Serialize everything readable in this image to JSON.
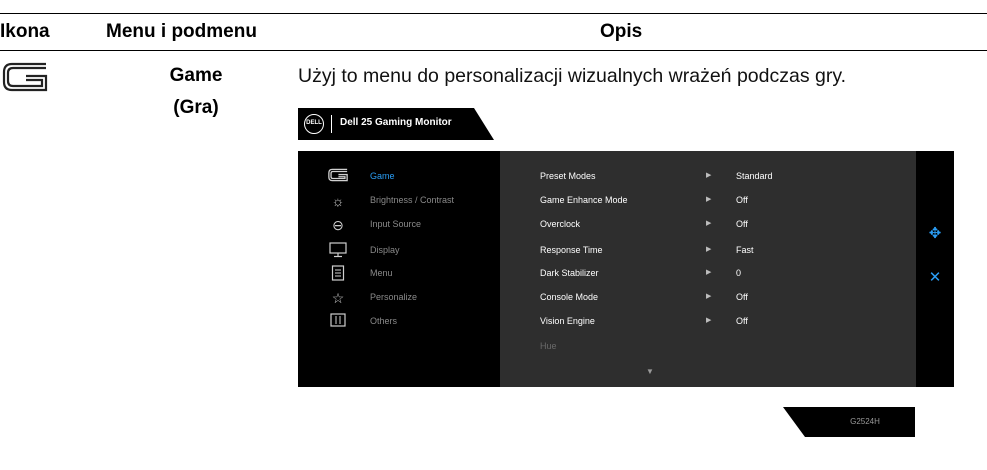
{
  "table": {
    "headers": {
      "icon": "Ikona",
      "menu": "Menu i podmenu",
      "description": "Opis"
    },
    "row": {
      "icon": "game-icon",
      "menu_line1": "Game",
      "menu_line2": "(Gra)",
      "description": "Użyj to menu do personalizacji wizualnych wrażeń podczas gry."
    }
  },
  "osd": {
    "logo_text": "DELL",
    "title": "Dell 25 Gaming Monitor",
    "nav": [
      {
        "label": "Game",
        "icon": "game-icon",
        "active": true
      },
      {
        "label": "Brightness / Contrast",
        "icon": "brightness-icon",
        "active": false
      },
      {
        "label": "Input Source",
        "icon": "input-source-icon",
        "active": false
      },
      {
        "label": "Display",
        "icon": "display-icon",
        "active": false
      },
      {
        "label": "Menu",
        "icon": "menu-icon",
        "active": false
      },
      {
        "label": "Personalize",
        "icon": "star-icon",
        "active": false
      },
      {
        "label": "Others",
        "icon": "others-icon",
        "active": false
      }
    ],
    "settings": [
      {
        "label": "Preset Modes",
        "value": "Standard"
      },
      {
        "label": "Game Enhance Mode",
        "value": "Off"
      },
      {
        "label": "Overclock",
        "value": "Off"
      },
      {
        "label": "Response Time",
        "value": "Fast"
      },
      {
        "label": "Dark Stabilizer",
        "value": "0"
      },
      {
        "label": "Console Mode",
        "value": "Off"
      },
      {
        "label": "Vision Engine",
        "value": "Off"
      },
      {
        "label": "Hue",
        "value": ""
      }
    ],
    "side_icons": [
      "move-icon",
      "close-icon"
    ],
    "model": "G2524H",
    "colors": {
      "accent": "#2a9df4",
      "panel_dark": "#000000",
      "panel_mid": "#2e2e2e"
    }
  }
}
